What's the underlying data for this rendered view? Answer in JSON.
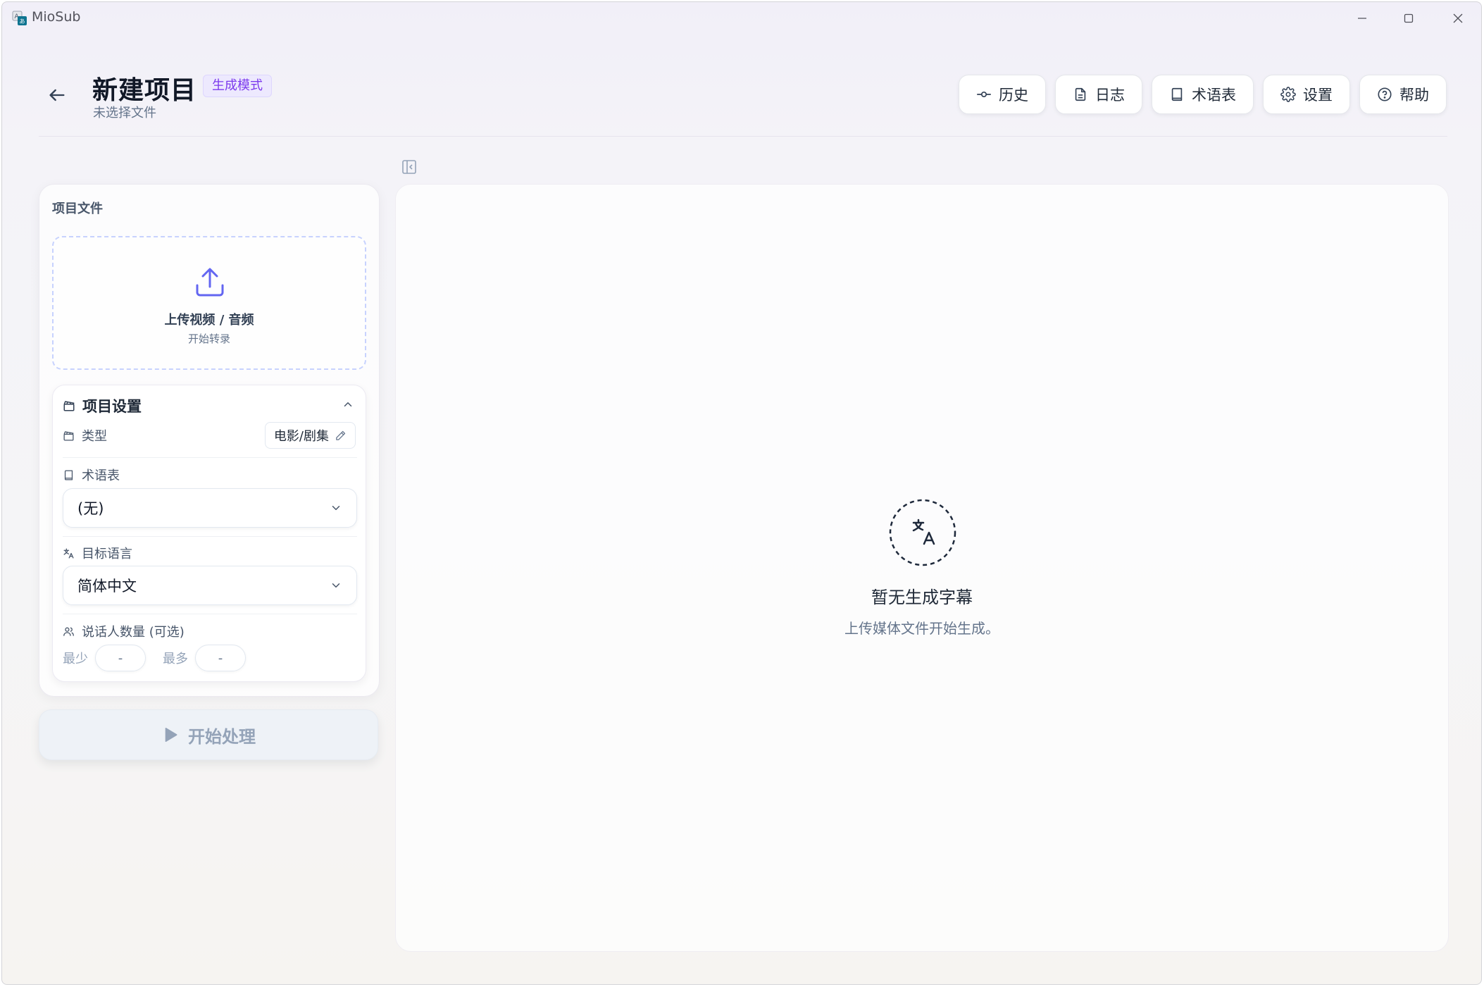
{
  "window": {
    "title": "MioSub",
    "controls": [
      "minimize-icon",
      "maximize-icon",
      "close-icon"
    ]
  },
  "header": {
    "title": "新建项目",
    "mode_badge": "生成模式",
    "subtitle": "未选择文件",
    "buttons": [
      {
        "label": "历史",
        "icon": "commit-icon"
      },
      {
        "label": "日志",
        "icon": "file-text-icon"
      },
      {
        "label": "术语表",
        "icon": "book-icon"
      },
      {
        "label": "设置",
        "icon": "gear-icon"
      },
      {
        "label": "帮助",
        "icon": "help-circle-icon"
      }
    ]
  },
  "left_panel": {
    "section_title": "项目文件",
    "upload": {
      "title": "上传视频 / 音频",
      "subtitle": "开始转录"
    },
    "settings": {
      "title": "项目设置",
      "type_label": "类型",
      "type_value": "电影/剧集",
      "glossary_label": "术语表",
      "glossary_value": "(无)",
      "target_lang_label": "目标语言",
      "target_lang_value": "简体中文",
      "speaker_label": "说话人数量 (可选)",
      "min_label": "最少",
      "min_value": "-",
      "max_label": "最多",
      "max_value": "-"
    },
    "start_button": "开始处理"
  },
  "main_panel": {
    "empty_title": "暂无生成字幕",
    "empty_subtitle": "上传媒体文件开始生成。"
  },
  "colors": {
    "accent": "#7c3aed",
    "badge_bg": "#ede9fe",
    "upload_icon": "#6366f1"
  }
}
